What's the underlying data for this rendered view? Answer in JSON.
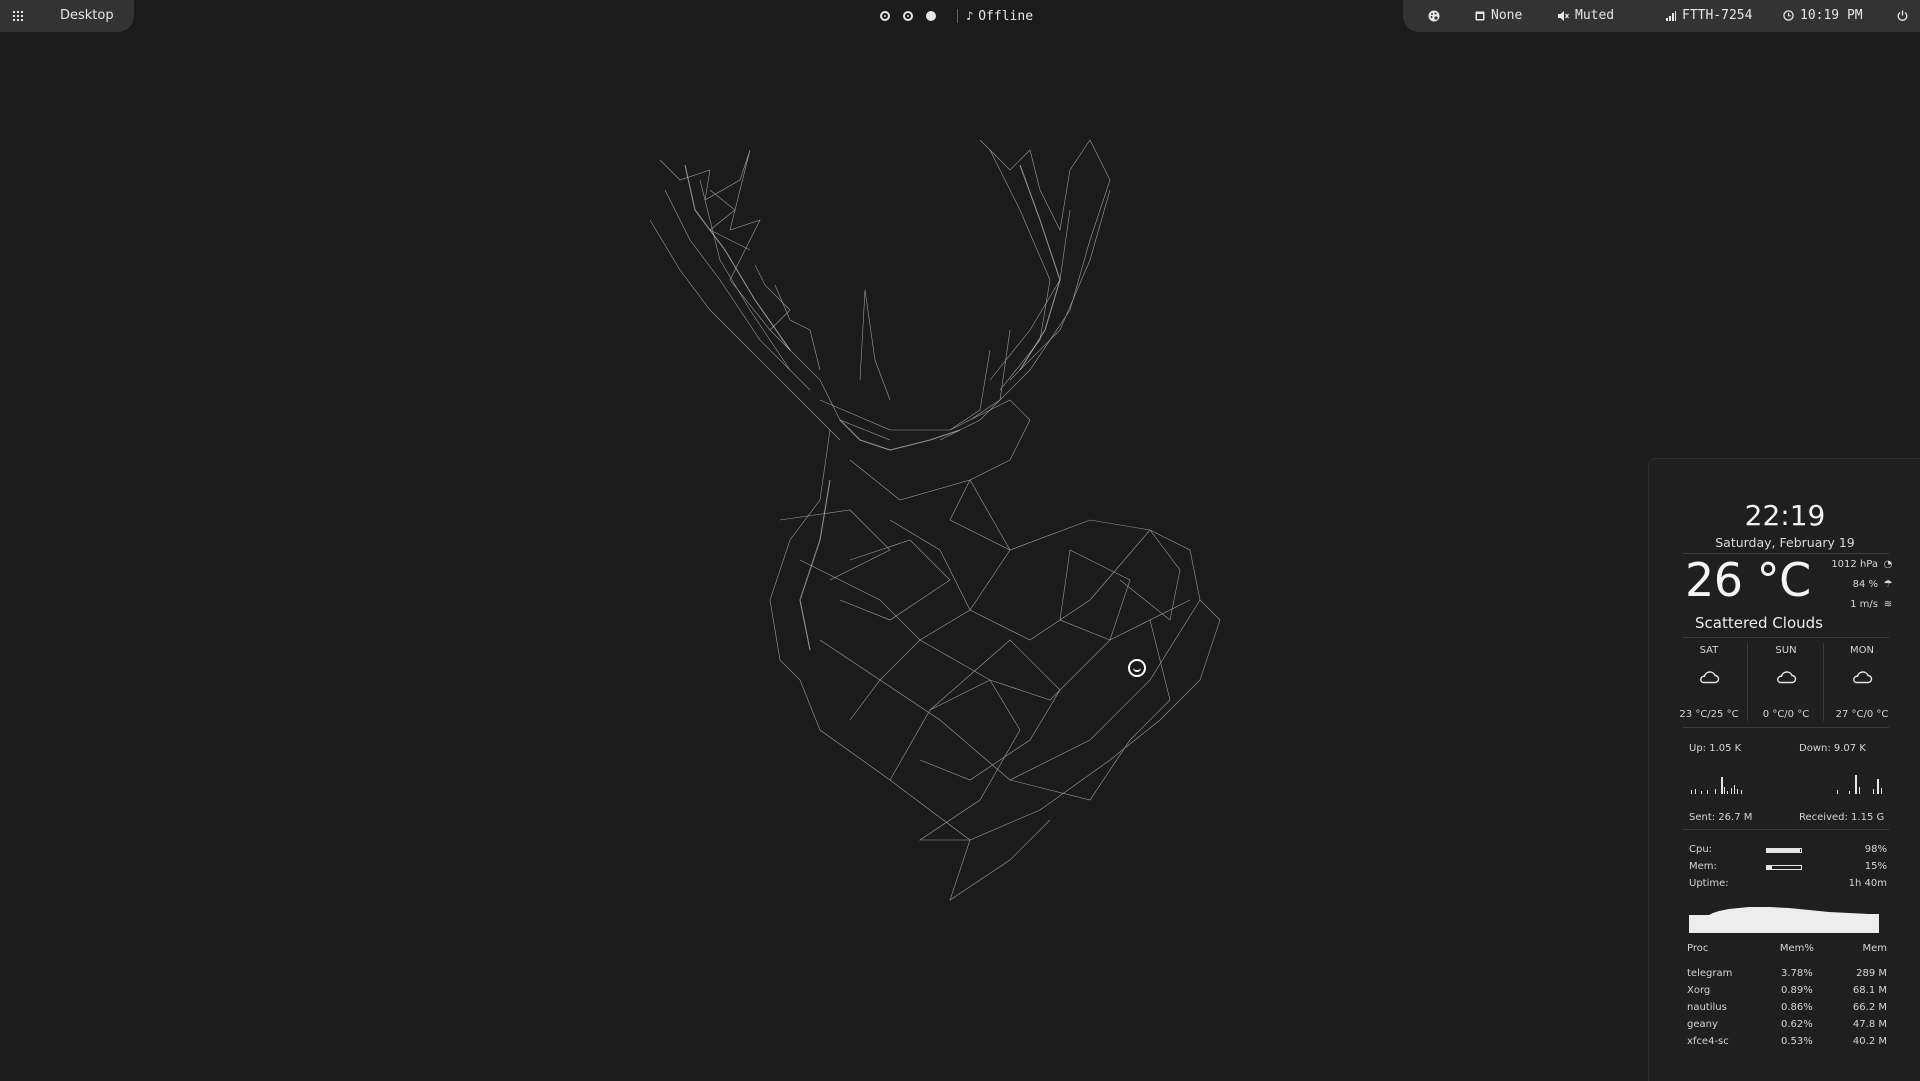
{
  "topbar": {
    "left": {
      "apps_icon": "grid-icon",
      "label": "Desktop"
    },
    "center": {
      "workspaces": [
        "ring",
        "ring",
        "filled"
      ],
      "music_icon": "music-note-icon",
      "music_status": "Offline"
    },
    "right": {
      "palette_icon": "palette-icon",
      "window_icon": "window-icon",
      "window_label": "None",
      "volume_icon": "speaker-muted-icon",
      "volume_label": "Muted",
      "wifi_icon": "signal-icon",
      "wifi_label": "FTTH-7254",
      "clock_icon": "clock-icon",
      "clock_label": "10:19 PM",
      "power_icon": "power-icon"
    }
  },
  "panel": {
    "clock": "22:19",
    "date": "Saturday, February 19",
    "temperature": "26 °C",
    "pressure": "1012 hPa",
    "humidity": "84 %",
    "wind": "1 m/s",
    "condition": "Scattered Clouds",
    "forecast": [
      {
        "day": "SAT",
        "icon": "cloud-icon",
        "temp": "23 °C/25 °C"
      },
      {
        "day": "SUN",
        "icon": "cloud-icon",
        "temp": "0 °C/0 °C"
      },
      {
        "day": "MON",
        "icon": "cloud-icon",
        "temp": "27 °C/0 °C"
      }
    ],
    "net": {
      "up": "Up: 1.05 K",
      "down": "Down: 9.07 K",
      "sent": "Sent: 26.7 M",
      "received": "Received: 1.15 G"
    },
    "sys": {
      "cpu_label": "Cpu:",
      "cpu_value": "98%",
      "cpu_fill": 0.98,
      "mem_label": "Mem:",
      "mem_value": "15%",
      "mem_fill": 0.15,
      "uptime_label": "Uptime:",
      "uptime_value": "1h 40m"
    },
    "proc_headers": [
      "Proc",
      "Mem%",
      "Mem"
    ],
    "procs": [
      {
        "name": "telegram",
        "pct": "3.78%",
        "mem": "289 M"
      },
      {
        "name": "Xorg",
        "pct": "0.89%",
        "mem": "68.1 M"
      },
      {
        "name": "nautilus",
        "pct": "0.86%",
        "mem": "66.2 M"
      },
      {
        "name": "geany",
        "pct": "0.62%",
        "mem": "47.8 M"
      },
      {
        "name": "xfce4-sc",
        "pct": "0.53%",
        "mem": "40.2 M"
      }
    ]
  },
  "colors": {
    "background": "#1b1b1b",
    "bar": "#333333",
    "text": "#e6e6e6"
  }
}
